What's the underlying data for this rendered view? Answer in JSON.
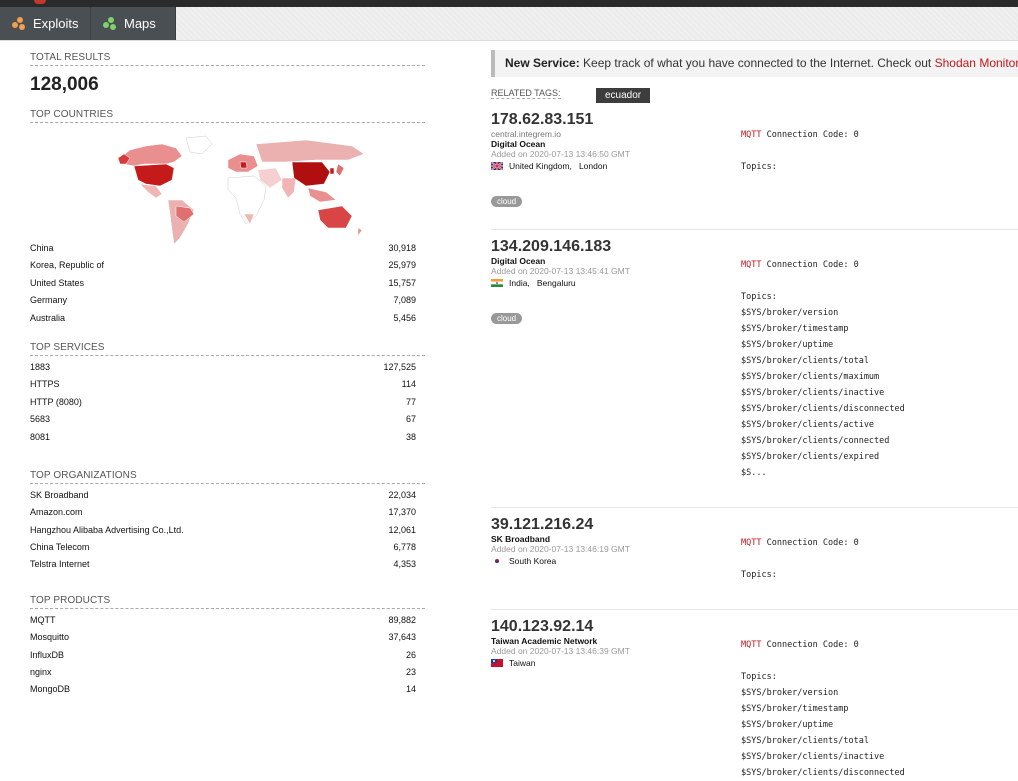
{
  "nav": {
    "tabs": [
      {
        "label": "Exploits",
        "icon": "exploits-icon"
      },
      {
        "label": "Maps",
        "icon": "maps-icon"
      }
    ]
  },
  "summary": {
    "total_label": "TOTAL RESULTS",
    "total": "128,006"
  },
  "countries": {
    "title": "TOP COUNTRIES",
    "items": [
      {
        "name": "China",
        "count": "30,918"
      },
      {
        "name": "Korea, Republic of",
        "count": "25,979"
      },
      {
        "name": "United States",
        "count": "15,757"
      },
      {
        "name": "Germany",
        "count": "7,089"
      },
      {
        "name": "Australia",
        "count": "5,456"
      }
    ]
  },
  "services": {
    "title": "TOP SERVICES",
    "items": [
      {
        "name": "1883",
        "count": "127,525"
      },
      {
        "name": "HTTPS",
        "count": "114"
      },
      {
        "name": "HTTP (8080)",
        "count": "77"
      },
      {
        "name": "5683",
        "count": "67"
      },
      {
        "name": "8081",
        "count": "38"
      }
    ]
  },
  "organizations": {
    "title": "TOP ORGANIZATIONS",
    "items": [
      {
        "name": "SK Broadband",
        "count": "22,034"
      },
      {
        "name": "Amazon.com",
        "count": "17,370"
      },
      {
        "name": "Hangzhou Alibaba Advertising Co.,Ltd.",
        "count": "12,061"
      },
      {
        "name": "China Telecom",
        "count": "6,778"
      },
      {
        "name": "Telstra Internet",
        "count": "4,353"
      }
    ]
  },
  "products": {
    "title": "TOP PRODUCTS",
    "items": [
      {
        "name": "MQTT",
        "count": "89,882"
      },
      {
        "name": "Mosquitto",
        "count": "37,643"
      },
      {
        "name": "InfluxDB",
        "count": "26"
      },
      {
        "name": "nginx",
        "count": "23"
      },
      {
        "name": "MongoDB",
        "count": "14"
      }
    ]
  },
  "notice": {
    "bold": "New Service:",
    "text": " Keep track of what you have connected to the Internet. Check out ",
    "link": "Shodan Monitor"
  },
  "related": {
    "label": "RELATED TAGS:",
    "tag": "ecuador"
  },
  "results": [
    {
      "ip": "178.62.83.151",
      "host": "central.integrem.io",
      "org": "Digital Ocean",
      "added": "Added on 2020-07-13 13:46:50 GMT",
      "country": "United Kingdom,",
      "city": "London",
      "flag": "uk",
      "tag": "cloud",
      "mqtt": "MQTT",
      "code": " Connection Code: 0",
      "topics_label": "Topics:",
      "topics": []
    },
    {
      "ip": "134.209.146.183",
      "host": "",
      "org": "Digital Ocean",
      "added": "Added on 2020-07-13 13:45:41 GMT",
      "country": "India,",
      "city": "Bengaluru",
      "flag": "in",
      "tag": "cloud",
      "mqtt": "MQTT",
      "code": " Connection Code: 0",
      "topics_label": "Topics:",
      "topics": [
        "$SYS/broker/version",
        "$SYS/broker/timestamp",
        "$SYS/broker/uptime",
        "$SYS/broker/clients/total",
        "$SYS/broker/clients/maximum",
        "$SYS/broker/clients/inactive",
        "$SYS/broker/clients/disconnected",
        "$SYS/broker/clients/active",
        "$SYS/broker/clients/connected",
        "$SYS/broker/clients/expired",
        "$S..."
      ]
    },
    {
      "ip": "39.121.216.24",
      "host": "",
      "org": "SK Broadband",
      "added": "Added on 2020-07-13 13:46:19 GMT",
      "country": "South Korea",
      "city": "",
      "flag": "kr",
      "tag": "",
      "mqtt": "MQTT",
      "code": " Connection Code: 0",
      "topics_label": "Topics:",
      "topics": []
    },
    {
      "ip": "140.123.92.14",
      "host": "",
      "org": "Taiwan Academic Network",
      "added": "Added on 2020-07-13 13:46:39 GMT",
      "country": "Taiwan",
      "city": "",
      "flag": "tw",
      "tag": "",
      "mqtt": "MQTT",
      "code": " Connection Code: 0",
      "topics_label": "Topics:",
      "topics": [
        "$SYS/broker/version",
        "$SYS/broker/timestamp",
        "$SYS/broker/uptime",
        "$SYS/broker/clients/total",
        "$SYS/broker/clients/inactive",
        "$SYS/broker/clients/disconnected"
      ]
    }
  ]
}
